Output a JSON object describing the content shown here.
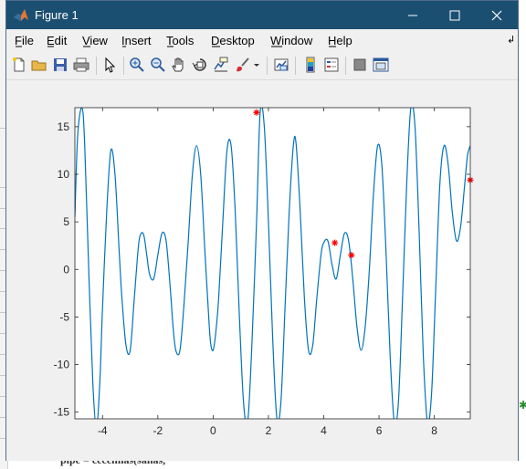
{
  "window": {
    "title": "Figure 1"
  },
  "titlebar_buttons": [
    {
      "name": "minimize-button",
      "glyph": "—"
    },
    {
      "name": "maximize-button",
      "glyph": "☐"
    },
    {
      "name": "close-button",
      "glyph": "✕"
    }
  ],
  "menu": [
    "File",
    "Edit",
    "View",
    "Insert",
    "Tools",
    "Desktop",
    "Window",
    "Help"
  ],
  "menu_underlines": [
    "F",
    "E",
    "V",
    "I",
    "T",
    "D",
    "W",
    "H"
  ],
  "menu_arrow": "↲",
  "toolbar_icons": [
    "new-figure-icon",
    "open-file-icon",
    "save-icon",
    "print-icon",
    "edit-plot-arrow-icon",
    "zoom-in-icon",
    "zoom-out-icon",
    "pan-hand-icon",
    "rotate-3d-icon",
    "data-cursor-icon",
    "brush-icon",
    "brush-dropdown-icon",
    "link-plot-icon",
    "insert-colorbar-icon",
    "insert-legend-icon",
    "hide-plot-tools-icon",
    "show-plot-tools-icon"
  ],
  "background": {
    "bottom_text": "plpe = cecennas(sanas,"
  },
  "chart_data": {
    "type": "line",
    "title": "",
    "xlabel": "",
    "ylabel": "",
    "xlim": [
      -5,
      9.3
    ],
    "ylim": [
      -15.7,
      17
    ],
    "xticks": [
      -4,
      -2,
      0,
      2,
      4,
      6,
      8
    ],
    "yticks": [
      -15,
      -10,
      -5,
      0,
      5,
      10,
      15
    ],
    "xtick_labels": [
      "-4",
      "-2",
      "0",
      "2",
      "4",
      "6",
      "8"
    ],
    "ytick_labels": [
      "-15",
      "-10",
      "-5",
      "0",
      "5",
      "10",
      "15"
    ],
    "grid": false,
    "box": true,
    "series": [
      {
        "style": "line",
        "color": "#0072bd",
        "x": [
          -5.0,
          -4.9,
          -4.75,
          -4.65,
          -4.5,
          -4.35,
          -4.22,
          -4.1,
          -4.0,
          -3.85,
          -3.7,
          -3.55,
          -3.4,
          -3.3,
          -3.15,
          -3.0,
          -2.85,
          -2.7,
          -2.6,
          -2.5,
          -2.4,
          -2.3,
          -2.15,
          -2.0,
          -1.85,
          -1.7,
          -1.55,
          -1.45,
          -1.35,
          -1.2,
          -1.05,
          -0.9,
          -0.75,
          -0.6,
          -0.45,
          -0.3,
          -0.2,
          -0.1,
          0.0,
          0.1,
          0.2,
          0.35,
          0.5,
          0.65,
          0.8,
          0.95,
          1.1,
          1.25,
          1.4,
          1.57,
          1.7,
          1.85,
          2.0,
          2.15,
          2.3,
          2.45,
          2.6,
          2.75,
          2.9,
          3.0,
          3.15,
          3.3,
          3.45,
          3.6,
          3.75,
          3.9,
          4.0,
          4.15,
          4.3,
          4.45,
          4.6,
          4.75,
          4.9,
          5.05,
          5.2,
          5.35,
          5.5,
          5.65,
          5.8,
          5.95,
          6.1,
          6.25,
          6.4,
          6.55,
          6.7,
          6.85,
          7.0,
          7.15,
          7.3,
          7.45,
          7.6,
          7.75,
          7.9,
          8.05,
          8.2,
          8.35,
          8.5,
          8.65,
          8.8,
          8.95,
          9.1,
          9.2,
          9.3
        ],
        "y": [
          5.5,
          14.0,
          17.0,
          13.5,
          0.0,
          -12.0,
          -16.5,
          -12.0,
          -4.0,
          6.0,
          12.5,
          10.0,
          2.0,
          -3.0,
          -8.0,
          -8.5,
          -3.0,
          2.5,
          3.8,
          3.5,
          1.5,
          -0.5,
          -1.0,
          1.5,
          3.8,
          3.0,
          -2.0,
          -6.0,
          -8.5,
          -8.5,
          -3.5,
          3.0,
          10.0,
          13.0,
          10.0,
          2.0,
          -3.0,
          -7.5,
          -8.5,
          -6.5,
          -3.0,
          5.0,
          12.5,
          13.0,
          6.0,
          -5.0,
          -14.0,
          -16.0,
          -8.0,
          5.0,
          16.5,
          15.0,
          5.0,
          -7.0,
          -15.5,
          -14.0,
          -4.0,
          6.0,
          13.0,
          13.2,
          6.0,
          -3.0,
          -8.5,
          -8.0,
          -3.0,
          1.5,
          2.8,
          3.0,
          0.5,
          -1.0,
          1.5,
          3.8,
          3.0,
          -1.0,
          -6.0,
          -8.5,
          -6.0,
          0.0,
          8.0,
          13.0,
          11.0,
          2.0,
          -9.0,
          -16.0,
          -14.0,
          -3.0,
          9.0,
          17.0,
          15.0,
          4.0,
          -9.0,
          -16.0,
          -13.0,
          -2.0,
          9.0,
          13.0,
          11.0,
          6.0,
          3.0,
          4.5,
          9.0,
          12.0,
          13.0
        ]
      },
      {
        "style": "markers",
        "marker": "*",
        "color": "#ff0000",
        "x": [
          1.57,
          4.4,
          5.0,
          9.3
        ],
        "y": [
          16.5,
          2.8,
          1.5,
          9.4
        ]
      }
    ]
  }
}
